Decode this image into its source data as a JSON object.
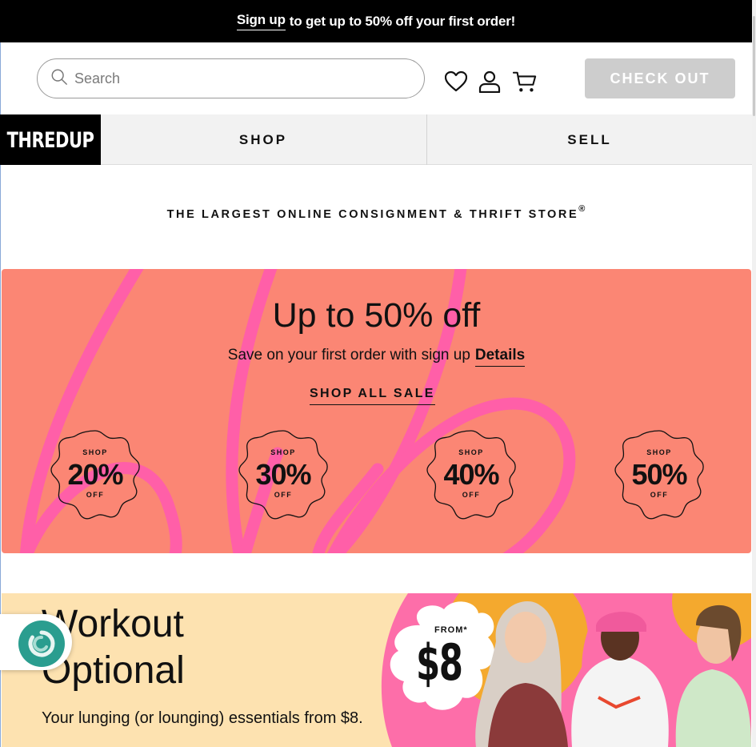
{
  "promo": {
    "link": "Sign up",
    "text": "to get up to 50% off your first order!"
  },
  "header": {
    "search_placeholder": "Search",
    "icons": [
      "heart-icon",
      "user-icon",
      "cart-icon"
    ],
    "checkout_label": "CHECK OUT"
  },
  "nav": {
    "logo": "THREDUP",
    "shop": "SHOP",
    "sell": "SELL"
  },
  "tagline": {
    "text": "THE LARGEST ONLINE CONSIGNMENT & THRIFT STORE",
    "mark": "®"
  },
  "sale": {
    "title": "Up to 50% off",
    "subtitle": "Save on your first order with sign up",
    "details": "Details",
    "shop_all": "SHOP ALL SALE",
    "badges": [
      {
        "top": "SHOP",
        "pct": "20%",
        "bottom": "OFF"
      },
      {
        "top": "SHOP",
        "pct": "30%",
        "bottom": "OFF"
      },
      {
        "top": "SHOP",
        "pct": "40%",
        "bottom": "OFF"
      },
      {
        "top": "SHOP",
        "pct": "50%",
        "bottom": "OFF"
      }
    ]
  },
  "workout": {
    "title_line1": "Workout",
    "title_line2": "Optional",
    "subtitle": "Your lunging (or lounging) essentials from $8.",
    "from_label": "FROM*",
    "price": "$8"
  },
  "colors": {
    "promo_bg": "#000000",
    "sale_bg": "#fb8674",
    "swirl": "#ff5fa8",
    "workout_bg": "#fde2b0",
    "checkout_bg": "#cdcdcd",
    "chat_button": "#2a9d8f"
  }
}
